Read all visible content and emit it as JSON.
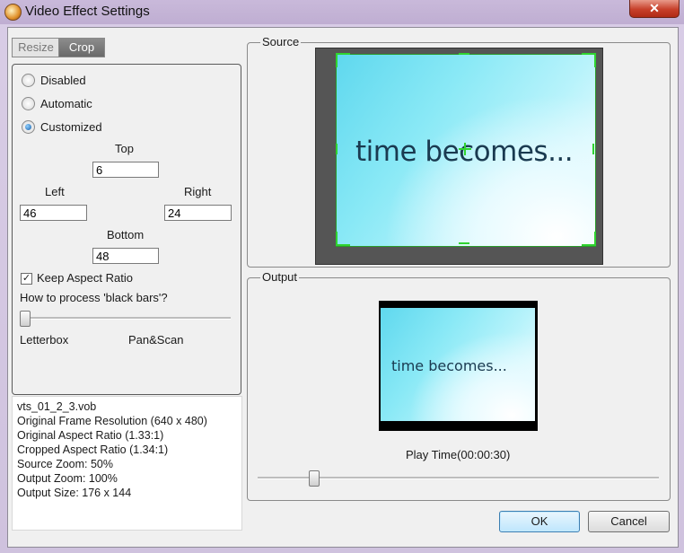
{
  "window": {
    "title": "Video Effect Settings",
    "close_glyph": "✕"
  },
  "tabs": [
    {
      "label": "Resize",
      "active": false
    },
    {
      "label": "Crop",
      "active": true
    }
  ],
  "crop": {
    "modes": [
      {
        "label": "Disabled",
        "checked": false
      },
      {
        "label": "Automatic",
        "checked": false
      },
      {
        "label": "Customized",
        "checked": true
      }
    ],
    "top_label": "Top",
    "top_value": "6",
    "left_label": "Left",
    "left_value": "46",
    "right_label": "Right",
    "right_value": "24",
    "bottom_label": "Bottom",
    "bottom_value": "48",
    "keep_aspect_label": "Keep Aspect Ratio",
    "keep_aspect_checked": true,
    "checkmark": "✓",
    "black_bars_label": "How to process 'black bars'?",
    "black_bars_level": 0,
    "letterbox_label": "Letterbox",
    "panscan_label": "Pan&Scan"
  },
  "info": {
    "lines": [
      "vts_01_2_3.vob",
      "Original Frame Resolution  (640 x 480)",
      "Original Aspect Ratio (1.33:1)",
      "Cropped Aspect Ratio (1.34:1)",
      "Source Zoom:  50%",
      "Output Zoom:  100%",
      "Output Size:  176 x 144"
    ]
  },
  "source": {
    "legend": "Source",
    "frame_text": "time becomes..."
  },
  "output": {
    "legend": "Output",
    "frame_text": "time becomes...",
    "play_time_label": "Play Time(00:00:30)",
    "seek_level": 0.13
  },
  "buttons": {
    "ok": "OK",
    "cancel": "Cancel"
  },
  "colors": {
    "crop_handle": "#2fd42f",
    "ok_border": "#3c7fb1"
  }
}
